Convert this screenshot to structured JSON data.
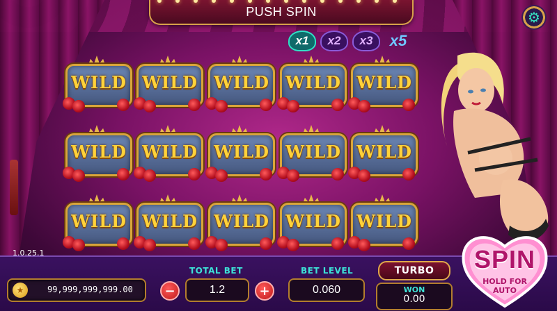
{
  "banner": {
    "title": "PUSH SPIN"
  },
  "multipliers": [
    "x1",
    "x2",
    "x3",
    "x5"
  ],
  "reel_symbol": "WILD",
  "version": "1.0.25.1",
  "balance": {
    "value": "99,999,999,999.00"
  },
  "total_bet": {
    "label": "TOTAL BET",
    "value": "1.2",
    "minus": "−",
    "plus": "+"
  },
  "bet_level": {
    "label": "BET LEVEL",
    "value": "0.060"
  },
  "turbo": {
    "label": "TURBO"
  },
  "won": {
    "label": "WON",
    "value": "0.00"
  },
  "spin": {
    "label": "SPIN",
    "sub1": "HOLD FOR",
    "sub2": "AUTO"
  },
  "icons": {
    "settings": "gear-icon",
    "coin": "coin-icon"
  },
  "colors": {
    "accent": "#3de2d7",
    "gold": "#d9a53a",
    "spin_pink": "#ff6ec7"
  }
}
